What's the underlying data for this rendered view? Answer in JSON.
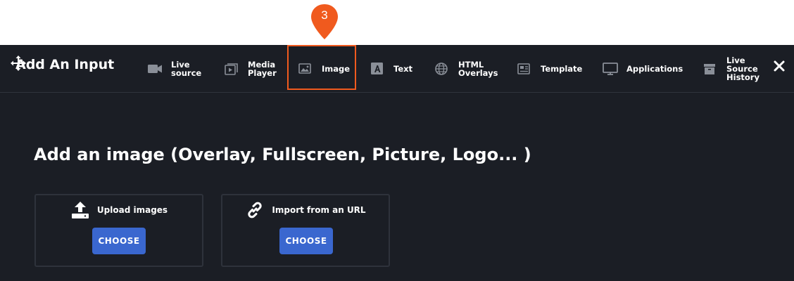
{
  "annotation": {
    "step_number": "3",
    "color": "#f05a1e"
  },
  "modal": {
    "title": "Add An Input",
    "close_icon": "close-icon"
  },
  "tabs": [
    {
      "label": "Live\nsource",
      "icon": "camera-icon",
      "selected": false
    },
    {
      "label": "Media\nPlayer",
      "icon": "media-player-icon",
      "selected": false
    },
    {
      "label": "Image",
      "icon": "image-icon",
      "selected": true
    },
    {
      "label": "Text",
      "icon": "text-icon",
      "selected": false
    },
    {
      "label": "HTML\nOverlays",
      "icon": "globe-icon",
      "selected": false
    },
    {
      "label": "Template",
      "icon": "template-icon",
      "selected": false
    },
    {
      "label": "Applications",
      "icon": "monitor-icon",
      "selected": false
    },
    {
      "label": "Live\nSource\nHistory",
      "icon": "archive-icon",
      "selected": false
    }
  ],
  "content": {
    "heading": "Add an image (Overlay, Fullscreen, Picture, Logo... )",
    "cards": [
      {
        "title": "Upload images",
        "icon": "upload-icon",
        "button_label": "CHOOSE"
      },
      {
        "title": "Import from an URL",
        "icon": "link-icon",
        "button_label": "CHOOSE"
      }
    ]
  },
  "colors": {
    "modal_background": "#1b1e25",
    "accent_button": "#3a67cf",
    "highlight_border": "#f05a1e",
    "icon_grey": "#8a8f98"
  }
}
